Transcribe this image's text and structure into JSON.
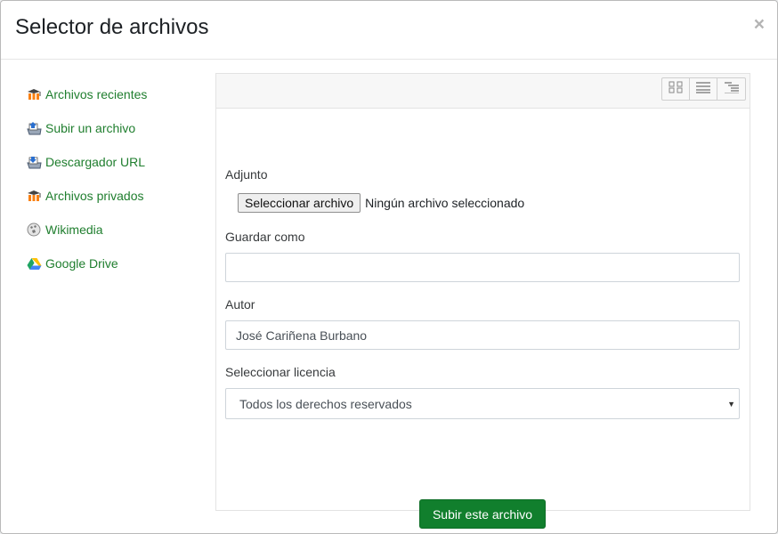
{
  "dialog": {
    "title": "Selector de archivos",
    "close_label": "×"
  },
  "sidebar": {
    "items": [
      {
        "label": "Archivos recientes",
        "icon": "moodle-icon"
      },
      {
        "label": "Subir un archivo",
        "icon": "upload-icon"
      },
      {
        "label": "Descargador URL",
        "icon": "download-icon"
      },
      {
        "label": "Archivos privados",
        "icon": "moodle-icon"
      },
      {
        "label": "Wikimedia",
        "icon": "wikimedia-icon"
      },
      {
        "label": "Google Drive",
        "icon": "google-drive-icon"
      }
    ]
  },
  "toolbar": {
    "view_buttons": [
      "icons-view-icon",
      "list-view-icon",
      "tree-view-icon"
    ]
  },
  "form": {
    "attachment_label": "Adjunto",
    "file_button_label": "Seleccionar archivo",
    "file_status": "Ningún archivo seleccionado",
    "save_as_label": "Guardar como",
    "save_as_value": "",
    "author_label": "Autor",
    "author_value": "José Cariñena Burbano",
    "license_label": "Seleccionar licencia",
    "license_selected": "Todos los derechos reservados",
    "submit_label": "Subir este archivo"
  },
  "colors": {
    "link": "#1f7e2e",
    "primary_button": "#117f2d"
  }
}
